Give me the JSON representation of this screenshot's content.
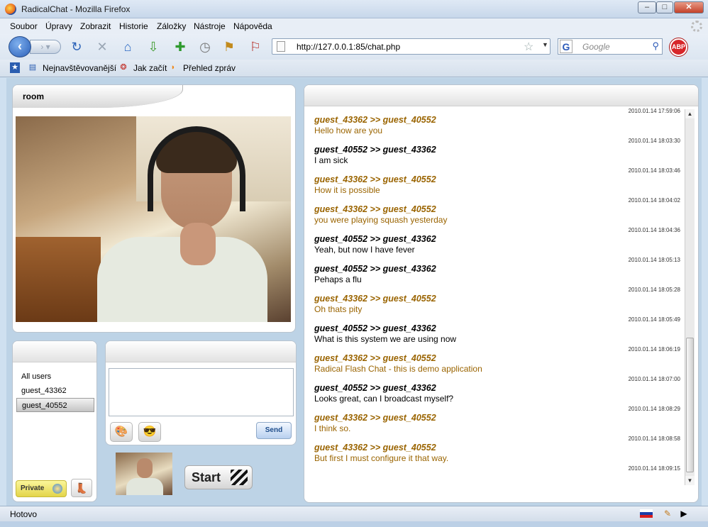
{
  "window": {
    "title": "RadicalChat - Mozilla Firefox"
  },
  "menu": [
    "Soubor",
    "Úpravy",
    "Zobrazit",
    "Historie",
    "Záložky",
    "Nástroje",
    "Nápověda"
  ],
  "address": {
    "url": "http://127.0.0.1:85/chat.php"
  },
  "search": {
    "placeholder": "Google"
  },
  "addon": {
    "abp_label": "ABP"
  },
  "bookmarks": [
    "Nejnavštěvovanější",
    "Jak začít",
    "Přehled zpráv"
  ],
  "room": {
    "title": "room"
  },
  "users": {
    "items": [
      "All users",
      "guest_43362",
      "guest_40552"
    ],
    "selected": "guest_40552"
  },
  "buttons": {
    "private": "Private",
    "send": "Send",
    "start": "Start"
  },
  "chat": {
    "messages": [
      {
        "ts": "2010.01.14 17:59:06",
        "who": "guest_43362 >> guest_40552",
        "text": "Hello how are you",
        "style": "a"
      },
      {
        "ts": "2010.01.14 18:03:30",
        "who": "guest_40552 >> guest_43362",
        "text": "I am sick",
        "style": "b"
      },
      {
        "ts": "2010.01.14 18:03:46",
        "who": "guest_43362 >> guest_40552",
        "text": "How it is possible",
        "style": "a"
      },
      {
        "ts": "2010.01.14 18:04:02",
        "who": "guest_43362 >> guest_40552",
        "text": "you were playing squash yesterday",
        "style": "a"
      },
      {
        "ts": "2010.01.14 18:04:36",
        "who": "guest_40552 >> guest_43362",
        "text": "Yeah, but now I have fever",
        "style": "b"
      },
      {
        "ts": "2010.01.14 18:05:13",
        "who": "guest_40552 >> guest_43362",
        "text": "Pehaps a flu",
        "style": "b"
      },
      {
        "ts": "2010.01.14 18:05:28",
        "who": "guest_43362 >> guest_40552",
        "text": "Oh thats pity",
        "style": "a"
      },
      {
        "ts": "2010.01.14 18:05:49",
        "who": "guest_40552 >> guest_43362",
        "text": "What is this system we are using now",
        "style": "b"
      },
      {
        "ts": "2010.01.14 18:06:19",
        "who": "guest_43362 >> guest_40552",
        "text": "Radical Flash Chat - this is demo application",
        "style": "a"
      },
      {
        "ts": "2010.01.14 18:07:00",
        "who": "guest_40552 >> guest_43362",
        "text": "Looks great, can I broadcast myself?",
        "style": "b"
      },
      {
        "ts": "2010.01.14 18:08:29",
        "who": "guest_43362 >> guest_40552",
        "text": "I think so.",
        "style": "a"
      },
      {
        "ts": "2010.01.14 18:08:58",
        "who": "guest_43362 >> guest_40552",
        "text": "But first I must configure it that way.",
        "style": "a"
      }
    ],
    "last_ts": "2010.01.14 18:09:15"
  },
  "status": {
    "text": "Hotovo"
  },
  "colors": {
    "own_message": "#9a6400",
    "other_message": "#000000"
  }
}
